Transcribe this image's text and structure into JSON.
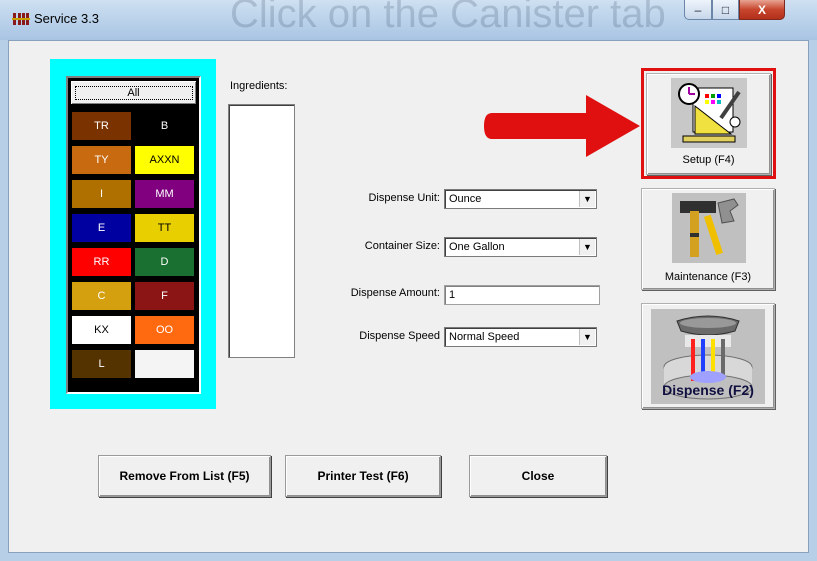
{
  "window": {
    "title": "Service 3.3",
    "background_caption": "Click on the Canister tab",
    "controls": {
      "minimize": "–",
      "maximize": "□",
      "close": "X"
    }
  },
  "colors": {
    "panel_border": "#00ffff",
    "highlight": "#e01010",
    "arrow": "#e01010"
  },
  "canister_grid": {
    "all_label": "All",
    "cells": [
      {
        "label": "TR",
        "bg": "#7a3300",
        "fg": "#ffffff"
      },
      {
        "label": "B",
        "bg": "#000000",
        "fg": "#ffffff"
      },
      {
        "label": "TY",
        "bg": "#c76a10",
        "fg": "#ffffff"
      },
      {
        "label": "AXXN",
        "bg": "#ffff00",
        "fg": "#000000"
      },
      {
        "label": "I",
        "bg": "#b07000",
        "fg": "#ffffff"
      },
      {
        "label": "MM",
        "bg": "#800080",
        "fg": "#ffffff"
      },
      {
        "label": "E",
        "bg": "#0000a0",
        "fg": "#ffffff"
      },
      {
        "label": "TT",
        "bg": "#e8d000",
        "fg": "#000000"
      },
      {
        "label": "RR",
        "bg": "#ff0000",
        "fg": "#ffffff"
      },
      {
        "label": "D",
        "bg": "#1a7030",
        "fg": "#ffffff"
      },
      {
        "label": "C",
        "bg": "#d4a010",
        "fg": "#ffffff"
      },
      {
        "label": "F",
        "bg": "#8b1515",
        "fg": "#ffffff"
      },
      {
        "label": "KX",
        "bg": "#ffffff",
        "fg": "#000000"
      },
      {
        "label": "OO",
        "bg": "#ff6a10",
        "fg": "#ffffff"
      },
      {
        "label": "L",
        "bg": "#553300",
        "fg": "#ffffff"
      },
      {
        "label": "",
        "bg": "#f4f4f4",
        "fg": "#000000"
      }
    ]
  },
  "ingredients": {
    "label": "Ingredients:"
  },
  "form": {
    "dispense_unit": {
      "label": "Dispense Unit:",
      "value": "Ounce"
    },
    "container_size": {
      "label": "Container Size:",
      "value": "One Gallon"
    },
    "dispense_amount": {
      "label": "Dispense Amount:",
      "value": "1"
    },
    "dispense_speed": {
      "label": "Dispense Speed",
      "value": "Normal Speed"
    }
  },
  "side_buttons": {
    "setup": "Setup (F4)",
    "maintenance": "Maintenance (F3)",
    "dispense": "Dispense (F2)"
  },
  "bottom_buttons": {
    "remove": "Remove From List (F5)",
    "printer_test": "Printer Test (F6)",
    "close": "Close"
  },
  "icons": [
    "app-icon",
    "setup-icon",
    "maintenance-icon",
    "dispense-icon",
    "dropdown-arrow-icon",
    "pointer-arrow-icon"
  ]
}
